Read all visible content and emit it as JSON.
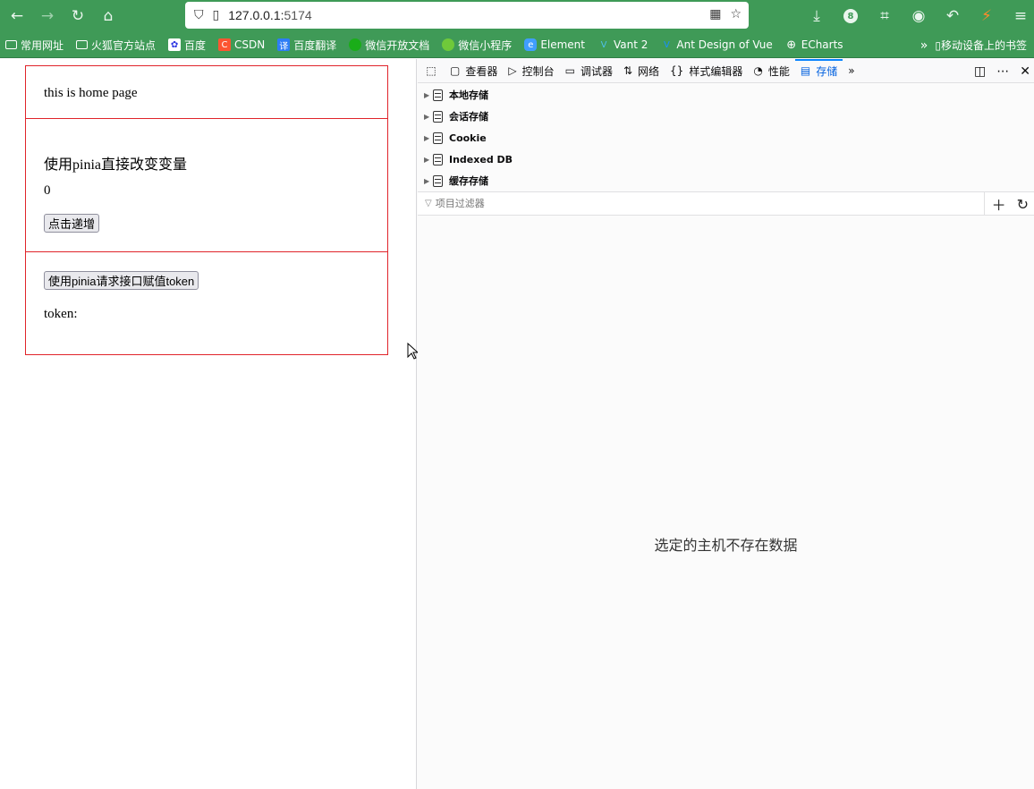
{
  "browser": {
    "url_host": "127.0.0.1:",
    "url_port": "5174",
    "badge_count": "8"
  },
  "bookmarks": [
    {
      "label": "常用网址",
      "icon": "folder-icon"
    },
    {
      "label": "火狐官方站点",
      "icon": "folder-icon"
    },
    {
      "label": "百度",
      "icon": "baidu-icon"
    },
    {
      "label": "CSDN",
      "icon": "csdn-icon"
    },
    {
      "label": "百度翻译",
      "icon": "translate-icon"
    },
    {
      "label": "微信开放文档",
      "icon": "wechat-icon"
    },
    {
      "label": "微信小程序",
      "icon": "wechat-icon"
    },
    {
      "label": "Element",
      "icon": "element-icon"
    },
    {
      "label": "Vant 2",
      "icon": "vant-icon"
    },
    {
      "label": "Ant Design of Vue",
      "icon": "antd-icon"
    },
    {
      "label": "ECharts",
      "icon": "globe-icon"
    }
  ],
  "bookmarks_mobile": "移动设备上的书签",
  "page": {
    "home_text": "this is home page",
    "pinia_title": "使用pinia直接改变变量",
    "counter": "0",
    "increment_button": "点击递增",
    "token_button": "使用pinia请求接口赋值token",
    "token_label": "token:"
  },
  "devtools": {
    "tabs": [
      {
        "label": "查看器",
        "icon": "inspector-icon"
      },
      {
        "label": "控制台",
        "icon": "console-icon"
      },
      {
        "label": "调试器",
        "icon": "debugger-icon"
      },
      {
        "label": "网络",
        "icon": "network-icon"
      },
      {
        "label": "样式编辑器",
        "icon": "style-editor-icon"
      },
      {
        "label": "性能",
        "icon": "performance-icon"
      },
      {
        "label": "存储",
        "icon": "storage-icon",
        "active": true
      }
    ],
    "storage_tree": [
      "本地存储",
      "会话存储",
      "Cookie",
      "Indexed DB",
      "缓存存储"
    ],
    "filter_placeholder": "项目过滤器",
    "empty_message": "选定的主机不存在数据"
  },
  "colors": {
    "chrome_green": "#3f9a57",
    "box_border": "#e0242a",
    "active_tab": "#0060df"
  }
}
